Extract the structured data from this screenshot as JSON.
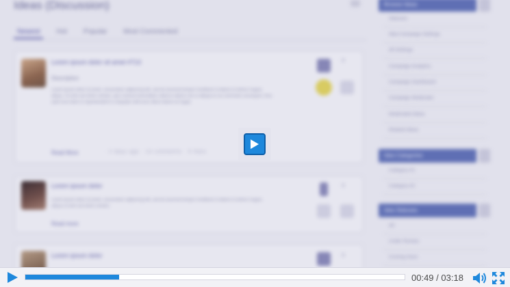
{
  "page": {
    "title": "Ideas (Discussion)",
    "tabs": [
      "Newest",
      "Hot",
      "Popular",
      "Most Commented"
    ]
  },
  "posts": [
    {
      "title": "Lorem ipsum dolor sit amet #713",
      "subtitle": "Description",
      "text": "Lorem ipsum dolor sit amet, consectetur adipiscing elit, sed do eiusmod tempor incididunt ut labore et dolore magna aliqua. Ut enim ad minim veniam, quis nostrud exercitation ullamco laboris nisi ut aliquip ex ea commodo consequat. Duis aute irure dolor in reprehenderit in voluptate velit esse cillum dolore eu fugiat.",
      "link": "Read More",
      "meta": "· 2 days ago · 14 comments · 5 likes",
      "count": "0"
    },
    {
      "title": "Lorem ipsum dolor",
      "text": "Lorem ipsum dolor sit amet, consectetur adipiscing elit, sed do eiusmod tempor incididunt ut labore et dolore magna aliqua ut enim ad minim veniam.",
      "link": "Read more",
      "count": "0"
    },
    {
      "title": "Lorem ipsum dolor",
      "count": "0"
    }
  ],
  "sidebar": {
    "sections": [
      {
        "header": "Browse Ideas",
        "items": [
          "Statuses",
          "Idea Campaign Settings",
          "All Settings",
          "Campaign Analytics",
          "Campaign Dashboard",
          "Campaign Moderator",
          "Moderated Ideas",
          "Related Ideas"
        ]
      },
      {
        "header": "Idea Categories",
        "items": [
          "Category #1",
          "Category #2"
        ]
      },
      {
        "header": "Idea Statuses",
        "items": [
          "All",
          "Under Review",
          "Coming Soon"
        ]
      }
    ]
  },
  "player": {
    "current_time": "00:49",
    "separator": "/",
    "duration": "03:18",
    "progress_fraction": 0.2474,
    "accent_color": "#1e88dc",
    "icons": {
      "center_play": "play-icon",
      "play": "play-icon",
      "volume": "volume-icon",
      "fullscreen": "fullscreen-icon"
    }
  }
}
